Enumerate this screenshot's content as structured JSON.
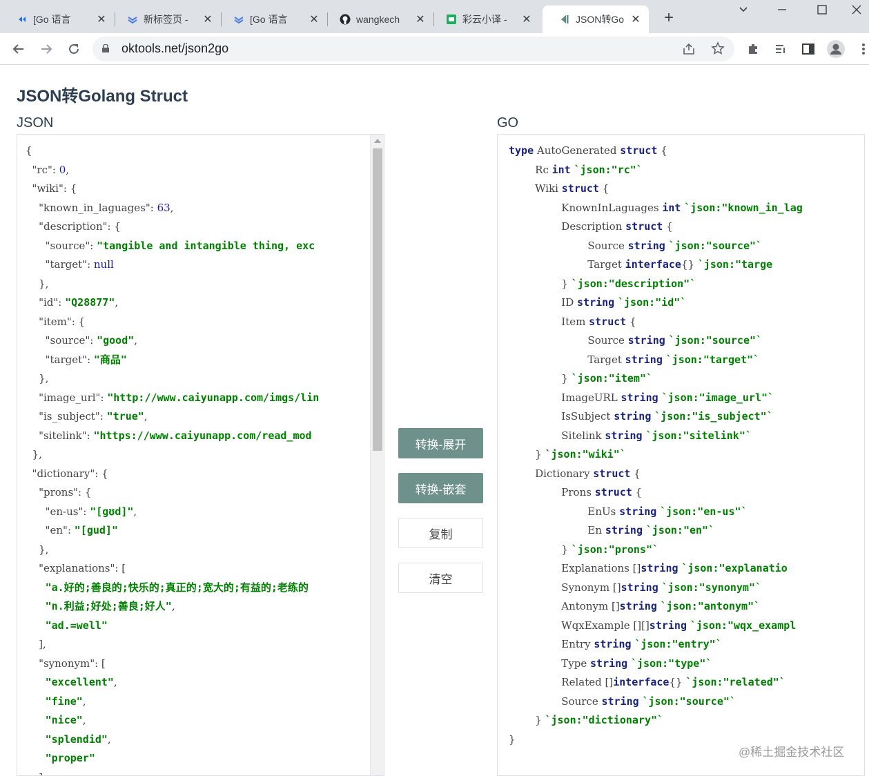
{
  "browser": {
    "tabs": [
      {
        "title": "[Go 语言",
        "icon": "go-icon"
      },
      {
        "title": "新标签页 -",
        "icon": "chevrons-icon"
      },
      {
        "title": "[Go 语言",
        "icon": "chevrons-icon"
      },
      {
        "title": "wangkech",
        "icon": "github-icon"
      },
      {
        "title": "彩云小译 -",
        "icon": "caiyun-icon"
      },
      {
        "title": "JSON转Go",
        "icon": "oktools-icon"
      }
    ],
    "close_glyph": "✕",
    "new_tab_glyph": "+",
    "url": "oktools.net/json2go"
  },
  "page": {
    "title": "JSON转Golang Struct",
    "json_label": "JSON",
    "go_label": "GO"
  },
  "buttons": {
    "expand": "转换-展开",
    "nested": "转换-嵌套",
    "copy": "复制",
    "clear": "清空"
  },
  "json_lines": [
    [
      [
        "p",
        "{"
      ]
    ],
    [
      [
        "p",
        "  "
      ],
      [
        "k",
        "\"rc\""
      ],
      [
        "p",
        ": "
      ],
      [
        "n",
        "0"
      ],
      [
        "p",
        ","
      ]
    ],
    [
      [
        "p",
        "  "
      ],
      [
        "k",
        "\"wiki\""
      ],
      [
        "p",
        ": {"
      ]
    ],
    [
      [
        "p",
        "    "
      ],
      [
        "k",
        "\"known_in_laguages\""
      ],
      [
        "p",
        ": "
      ],
      [
        "n",
        "63"
      ],
      [
        "p",
        ","
      ]
    ],
    [
      [
        "p",
        "    "
      ],
      [
        "k",
        "\"description\""
      ],
      [
        "p",
        ": {"
      ]
    ],
    [
      [
        "p",
        "      "
      ],
      [
        "k",
        "\"source\""
      ],
      [
        "p",
        ": "
      ],
      [
        "s",
        "\"tangible and intangible thing, exc"
      ]
    ],
    [
      [
        "p",
        "      "
      ],
      [
        "k",
        "\"target\""
      ],
      [
        "p",
        ": "
      ],
      [
        "n",
        "null"
      ]
    ],
    [
      [
        "p",
        "    },"
      ]
    ],
    [
      [
        "p",
        "    "
      ],
      [
        "k",
        "\"id\""
      ],
      [
        "p",
        ": "
      ],
      [
        "s",
        "\"Q28877\""
      ],
      [
        "p",
        ","
      ]
    ],
    [
      [
        "p",
        "    "
      ],
      [
        "k",
        "\"item\""
      ],
      [
        "p",
        ": {"
      ]
    ],
    [
      [
        "p",
        "      "
      ],
      [
        "k",
        "\"source\""
      ],
      [
        "p",
        ": "
      ],
      [
        "s",
        "\"good\""
      ],
      [
        "p",
        ","
      ]
    ],
    [
      [
        "p",
        "      "
      ],
      [
        "k",
        "\"target\""
      ],
      [
        "p",
        ": "
      ],
      [
        "s",
        "\"商品\""
      ]
    ],
    [
      [
        "p",
        "    },"
      ]
    ],
    [
      [
        "p",
        "    "
      ],
      [
        "k",
        "\"image_url\""
      ],
      [
        "p",
        ": "
      ],
      [
        "s",
        "\"http://www.caiyunapp.com/imgs/lin"
      ]
    ],
    [
      [
        "p",
        "    "
      ],
      [
        "k",
        "\"is_subject\""
      ],
      [
        "p",
        ": "
      ],
      [
        "s",
        "\"true\""
      ],
      [
        "p",
        ","
      ]
    ],
    [
      [
        "p",
        "    "
      ],
      [
        "k",
        "\"sitelink\""
      ],
      [
        "p",
        ": "
      ],
      [
        "s",
        "\"https://www.caiyunapp.com/read_mod"
      ]
    ],
    [
      [
        "p",
        "  },"
      ]
    ],
    [
      [
        "p",
        "  "
      ],
      [
        "k",
        "\"dictionary\""
      ],
      [
        "p",
        ": {"
      ]
    ],
    [
      [
        "p",
        "    "
      ],
      [
        "k",
        "\"prons\""
      ],
      [
        "p",
        ": {"
      ]
    ],
    [
      [
        "p",
        "      "
      ],
      [
        "k",
        "\"en-us\""
      ],
      [
        "p",
        ": "
      ],
      [
        "s",
        "\"[gʊd]\""
      ],
      [
        "p",
        ","
      ]
    ],
    [
      [
        "p",
        "      "
      ],
      [
        "k",
        "\"en\""
      ],
      [
        "p",
        ": "
      ],
      [
        "s",
        "\"[gud]\""
      ]
    ],
    [
      [
        "p",
        "    },"
      ]
    ],
    [
      [
        "p",
        "    "
      ],
      [
        "k",
        "\"explanations\""
      ],
      [
        "p",
        ": ["
      ]
    ],
    [
      [
        "p",
        "      "
      ],
      [
        "s",
        "\"a.好的;善良的;快乐的;真正的;宽大的;有益的;老练的"
      ]
    ],
    [
      [
        "p",
        "      "
      ],
      [
        "s",
        "\"n.利益;好处;善良;好人\""
      ],
      [
        "p",
        ","
      ]
    ],
    [
      [
        "p",
        "      "
      ],
      [
        "s",
        "\"ad.=well\""
      ]
    ],
    [
      [
        "p",
        "    ],"
      ]
    ],
    [
      [
        "p",
        "    "
      ],
      [
        "k",
        "\"synonym\""
      ],
      [
        "p",
        ": ["
      ]
    ],
    [
      [
        "p",
        "      "
      ],
      [
        "s",
        "\"excellent\""
      ],
      [
        "p",
        ","
      ]
    ],
    [
      [
        "p",
        "      "
      ],
      [
        "s",
        "\"fine\""
      ],
      [
        "p",
        ","
      ]
    ],
    [
      [
        "p",
        "      "
      ],
      [
        "s",
        "\"nice\""
      ],
      [
        "p",
        ","
      ]
    ],
    [
      [
        "p",
        "      "
      ],
      [
        "s",
        "\"splendid\""
      ],
      [
        "p",
        ","
      ]
    ],
    [
      [
        "p",
        "      "
      ],
      [
        "s",
        "\"proper\""
      ]
    ],
    [
      [
        "p",
        "    ],"
      ]
    ]
  ],
  "go_lines": [
    [
      [
        "w",
        "type"
      ],
      [
        "p",
        " AutoGenerated "
      ],
      [
        "w",
        "struct"
      ],
      [
        "p",
        " {"
      ]
    ],
    [
      [
        "p",
        "        Rc "
      ],
      [
        "w",
        "int"
      ],
      [
        "p",
        " "
      ],
      [
        "t",
        "`json:\"rc\"`"
      ]
    ],
    [
      [
        "p",
        "        Wiki "
      ],
      [
        "w",
        "struct"
      ],
      [
        "p",
        " {"
      ]
    ],
    [
      [
        "p",
        "                KnownInLaguages "
      ],
      [
        "w",
        "int"
      ],
      [
        "p",
        " "
      ],
      [
        "t",
        "`json:\"known_in_lag"
      ]
    ],
    [
      [
        "p",
        "                Description "
      ],
      [
        "w",
        "struct"
      ],
      [
        "p",
        " {"
      ]
    ],
    [
      [
        "p",
        "                        Source "
      ],
      [
        "w",
        "string"
      ],
      [
        "p",
        " "
      ],
      [
        "t",
        "`json:\"source\"`"
      ]
    ],
    [
      [
        "p",
        "                        Target "
      ],
      [
        "w",
        "interface"
      ],
      [
        "p",
        "{} "
      ],
      [
        "t",
        "`json:\"targe"
      ]
    ],
    [
      [
        "p",
        "                } "
      ],
      [
        "t",
        "`json:\"description\"`"
      ]
    ],
    [
      [
        "p",
        "                ID "
      ],
      [
        "w",
        "string"
      ],
      [
        "p",
        " "
      ],
      [
        "t",
        "`json:\"id\"`"
      ]
    ],
    [
      [
        "p",
        "                Item "
      ],
      [
        "w",
        "struct"
      ],
      [
        "p",
        " {"
      ]
    ],
    [
      [
        "p",
        "                        Source "
      ],
      [
        "w",
        "string"
      ],
      [
        "p",
        " "
      ],
      [
        "t",
        "`json:\"source\"`"
      ]
    ],
    [
      [
        "p",
        "                        Target "
      ],
      [
        "w",
        "string"
      ],
      [
        "p",
        " "
      ],
      [
        "t",
        "`json:\"target\"`"
      ]
    ],
    [
      [
        "p",
        "                } "
      ],
      [
        "t",
        "`json:\"item\"`"
      ]
    ],
    [
      [
        "p",
        "                ImageURL "
      ],
      [
        "w",
        "string"
      ],
      [
        "p",
        " "
      ],
      [
        "t",
        "`json:\"image_url\"`"
      ]
    ],
    [
      [
        "p",
        "                IsSubject "
      ],
      [
        "w",
        "string"
      ],
      [
        "p",
        " "
      ],
      [
        "t",
        "`json:\"is_subject\"`"
      ]
    ],
    [
      [
        "p",
        "                Sitelink "
      ],
      [
        "w",
        "string"
      ],
      [
        "p",
        " "
      ],
      [
        "t",
        "`json:\"sitelink\"`"
      ]
    ],
    [
      [
        "p",
        "        } "
      ],
      [
        "t",
        "`json:\"wiki\"`"
      ]
    ],
    [
      [
        "p",
        "        Dictionary "
      ],
      [
        "w",
        "struct"
      ],
      [
        "p",
        " {"
      ]
    ],
    [
      [
        "p",
        "                Prons "
      ],
      [
        "w",
        "struct"
      ],
      [
        "p",
        " {"
      ]
    ],
    [
      [
        "p",
        "                        EnUs "
      ],
      [
        "w",
        "string"
      ],
      [
        "p",
        " "
      ],
      [
        "t",
        "`json:\"en-us\"`"
      ]
    ],
    [
      [
        "p",
        "                        En "
      ],
      [
        "w",
        "string"
      ],
      [
        "p",
        " "
      ],
      [
        "t",
        "`json:\"en\"`"
      ]
    ],
    [
      [
        "p",
        "                } "
      ],
      [
        "t",
        "`json:\"prons\"`"
      ]
    ],
    [
      [
        "p",
        "                Explanations []"
      ],
      [
        "w",
        "string"
      ],
      [
        "p",
        " "
      ],
      [
        "t",
        "`json:\"explanatio"
      ]
    ],
    [
      [
        "p",
        "                Synonym []"
      ],
      [
        "w",
        "string"
      ],
      [
        "p",
        " "
      ],
      [
        "t",
        "`json:\"synonym\"`"
      ]
    ],
    [
      [
        "p",
        "                Antonym []"
      ],
      [
        "w",
        "string"
      ],
      [
        "p",
        " "
      ],
      [
        "t",
        "`json:\"antonym\"`"
      ]
    ],
    [
      [
        "p",
        "                WqxExample [][]"
      ],
      [
        "w",
        "string"
      ],
      [
        "p",
        " "
      ],
      [
        "t",
        "`json:\"wqx_exampl"
      ]
    ],
    [
      [
        "p",
        "                Entry "
      ],
      [
        "w",
        "string"
      ],
      [
        "p",
        " "
      ],
      [
        "t",
        "`json:\"entry\"`"
      ]
    ],
    [
      [
        "p",
        "                Type "
      ],
      [
        "w",
        "string"
      ],
      [
        "p",
        " "
      ],
      [
        "t",
        "`json:\"type\"`"
      ]
    ],
    [
      [
        "p",
        "                Related []"
      ],
      [
        "w",
        "interface"
      ],
      [
        "p",
        "{} "
      ],
      [
        "t",
        "`json:\"related\"`"
      ]
    ],
    [
      [
        "p",
        "                Source "
      ],
      [
        "w",
        "string"
      ],
      [
        "p",
        " "
      ],
      [
        "t",
        "`json:\"source\"`"
      ]
    ],
    [
      [
        "p",
        "        } "
      ],
      [
        "t",
        "`json:\"dictionary\"`"
      ]
    ],
    [
      [
        "p",
        "}"
      ]
    ]
  ],
  "watermark": "@稀土掘金技术社区"
}
